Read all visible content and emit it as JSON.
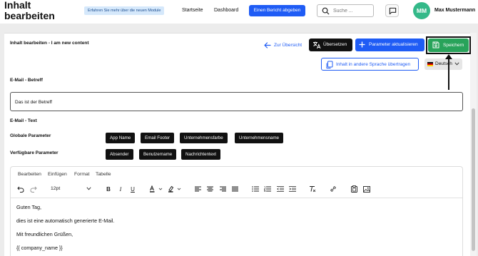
{
  "header": {
    "app_title_line1": "Inhalt",
    "app_title_line2": "bearbeiten",
    "promo_badge": "Erfahren Sie mehr über die neuen Module",
    "nav": [
      "Startseite",
      "Dashboard"
    ],
    "report_button": "Einen Bericht abgeben",
    "search_placeholder": "Suche ...",
    "user_initials": "MM",
    "user_name": "Max Mustermann",
    "avatar_color": "#34b989"
  },
  "page": {
    "heading": "Inhalt bearbeiten - I am new content",
    "back_link": "Zur Übersicht",
    "translate_button": "Übersetzen",
    "params_button": "Parameter aktualisieren",
    "save_button": "Speichern",
    "transfer_button": "Inhalt in andere Sprache übertragen",
    "language": "Deutsch"
  },
  "form": {
    "subject_label": "E-Mail - Betreff",
    "subject_value": "Das ist der Betreff",
    "text_label": "E-Mail - Text",
    "global_params_label": "Globale Parameter",
    "global_params": [
      "App Name",
      "Email Footer",
      "Unternehmensfarbe",
      "Unternehmensname"
    ],
    "available_params_label": "Verfügbare Parameter",
    "available_params": [
      "Absender",
      "Benutzername",
      "Nachrichtentext"
    ]
  },
  "editor": {
    "menu": [
      "Bearbeiten",
      "Einfügen",
      "Format",
      "Tabelle"
    ],
    "font_size": "12pt",
    "toolbar_icons": [
      "undo-icon",
      "redo-icon",
      "bold-icon",
      "italic-icon",
      "underline-icon",
      "text-color-icon",
      "highlight-icon",
      "align-left-icon",
      "align-center-icon",
      "align-right-icon",
      "align-justify-icon",
      "bullet-list-icon",
      "numbered-list-icon",
      "outdent-icon",
      "indent-icon",
      "clear-format-icon",
      "link-icon",
      "paste-icon",
      "image-icon"
    ],
    "content": [
      "Guten Tag,",
      "dies ist eine automatisch generierte E-Mail.",
      "Mit freundlichen Grüßen,",
      "{{ company_name }}"
    ]
  },
  "colors": {
    "primary": "#1f5cf5",
    "save": "#28a35a",
    "dark": "#111111"
  }
}
